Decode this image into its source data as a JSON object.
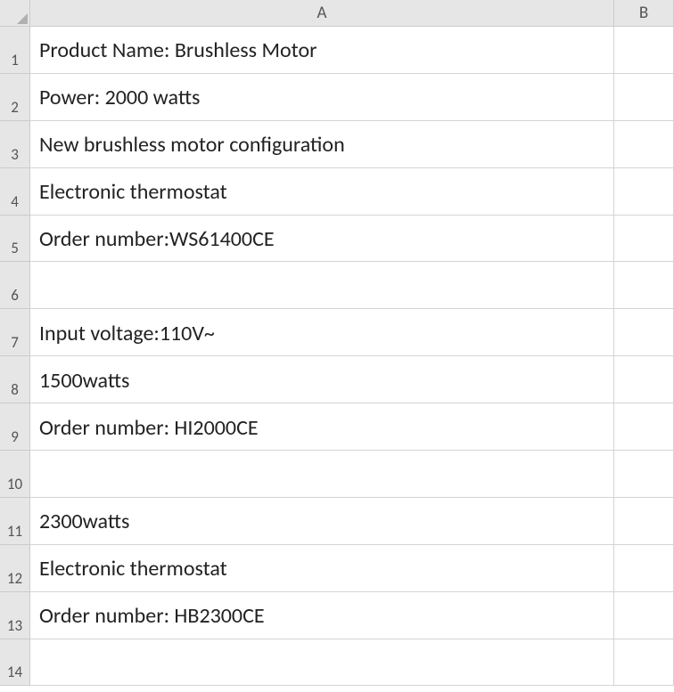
{
  "columns": {
    "A": "A",
    "B": "B"
  },
  "rows": [
    {
      "num": "1",
      "A": "Product Name: Brushless Motor",
      "B": ""
    },
    {
      "num": "2",
      "A": "Power: 2000 watts",
      "B": ""
    },
    {
      "num": "3",
      "A": "New brushless motor configuration",
      "B": ""
    },
    {
      "num": "4",
      "A": "Electronic thermostat",
      "B": ""
    },
    {
      "num": "5",
      "A": "Order number:WS61400CE",
      "B": ""
    },
    {
      "num": "6",
      "A": "",
      "B": ""
    },
    {
      "num": "7",
      "A": "Input voltage:110V~",
      "B": ""
    },
    {
      "num": "8",
      "A": "1500watts",
      "B": ""
    },
    {
      "num": "9",
      "A": "Order number: HI2000CE",
      "B": ""
    },
    {
      "num": "10",
      "A": "",
      "B": ""
    },
    {
      "num": "11",
      "A": "2300watts",
      "B": ""
    },
    {
      "num": "12",
      "A": "Electronic thermostat",
      "B": ""
    },
    {
      "num": "13",
      "A": "Order number: HB2300CE",
      "B": ""
    },
    {
      "num": "14",
      "A": "",
      "B": ""
    }
  ]
}
